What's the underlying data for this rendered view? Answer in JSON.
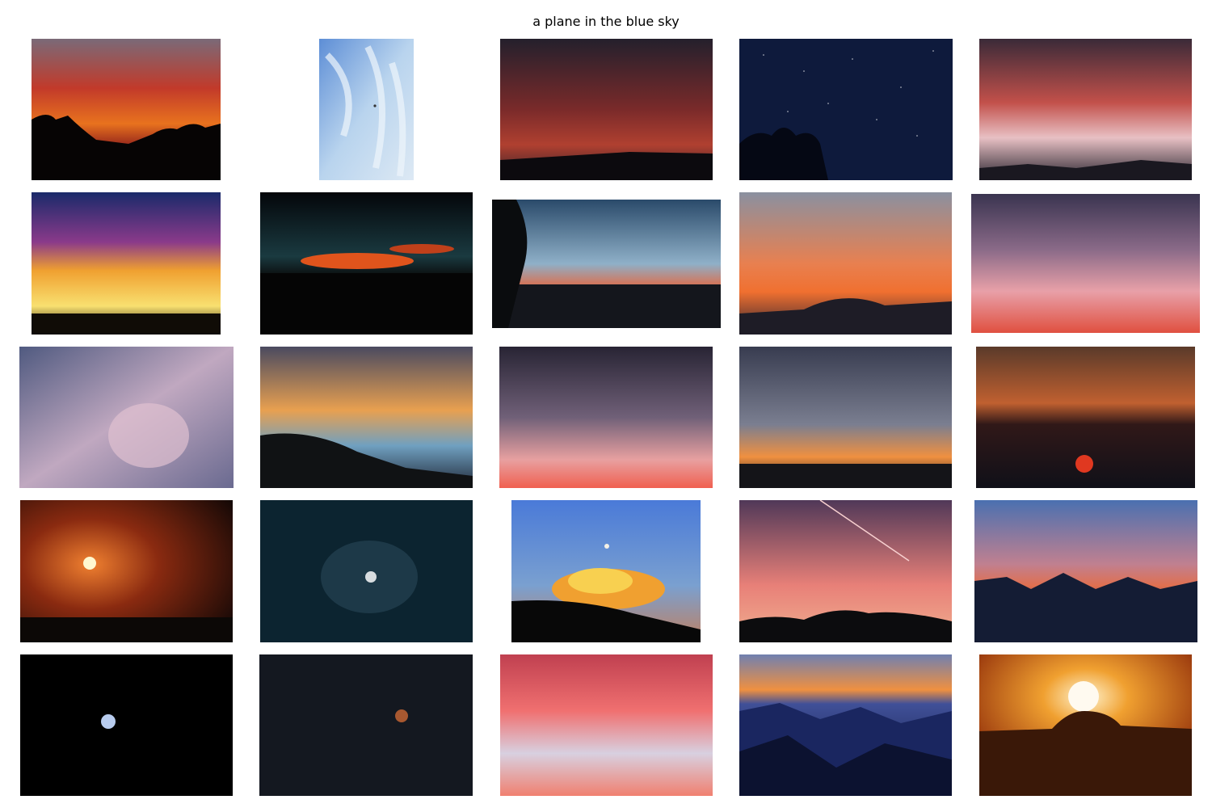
{
  "title": "a plane in the blue sky",
  "images": [
    {
      "name": "image-sunset-red-clouds-trees"
    },
    {
      "name": "image-blue-sky-cirrus-plane"
    },
    {
      "name": "image-dark-red-clouds"
    },
    {
      "name": "image-starry-night-tree"
    },
    {
      "name": "image-pink-clouds-mountains"
    },
    {
      "name": "image-blue-purple-yellow-sunset"
    },
    {
      "name": "image-dark-orange-cloud-horizon"
    },
    {
      "name": "image-blue-dusk-city-lights"
    },
    {
      "name": "image-orange-mackerel-sky"
    },
    {
      "name": "image-pink-layered-clouds"
    },
    {
      "name": "image-purple-storm-clouds"
    },
    {
      "name": "image-golden-streaked-clouds-hill"
    },
    {
      "name": "image-pink-dusk-clouds"
    },
    {
      "name": "image-gray-clouds-orange-horizon"
    },
    {
      "name": "image-red-sun-on-horizon"
    },
    {
      "name": "image-orange-sun-layered-clouds"
    },
    {
      "name": "image-moon-behind-clouds-teal"
    },
    {
      "name": "image-moon-over-glowing-cloud"
    },
    {
      "name": "image-contrail-pink-sky"
    },
    {
      "name": "image-blue-mountains-dusk"
    },
    {
      "name": "image-full-moon-black-sky"
    },
    {
      "name": "image-red-moon-dark-sky"
    },
    {
      "name": "image-red-clouds-blue-gaps"
    },
    {
      "name": "image-blue-mountain-ridges"
    },
    {
      "name": "image-sun-over-mountain-orange"
    }
  ]
}
